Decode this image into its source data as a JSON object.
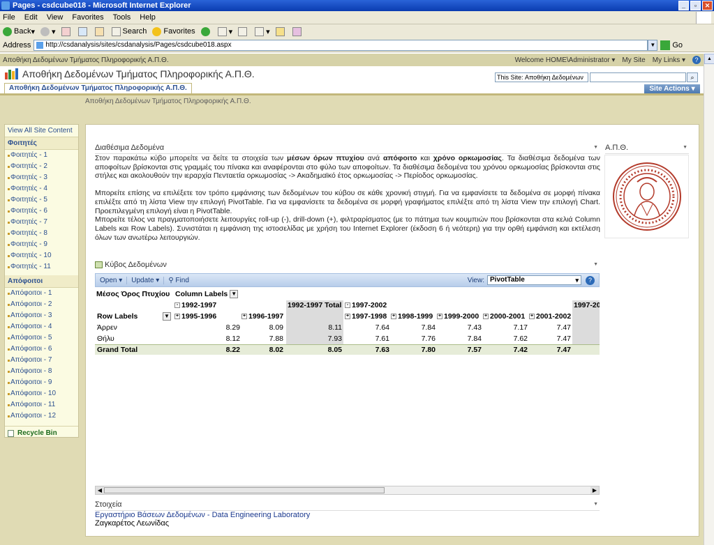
{
  "window": {
    "title": "Pages - csdcube018 - Microsoft Internet Explorer",
    "controls": [
      "_",
      "▫",
      "✕"
    ]
  },
  "menu": [
    "File",
    "Edit",
    "View",
    "Favorites",
    "Tools",
    "Help"
  ],
  "toolbar": {
    "back": "Back",
    "search": "Search",
    "favorites": "Favorites"
  },
  "address": {
    "label": "Address",
    "url": "http://csdanalysis/sites/csdanalysis/Pages/csdcube018.aspx",
    "go": "Go"
  },
  "sp_top": {
    "site_label": "Αποθήκη Δεδομένων Τμήματος Πληροφορικής Α.Π.Θ.",
    "welcome": "Welcome HOME\\Administrator ▾",
    "mysite": "My Site",
    "mylinks": "My Links ▾",
    "help": "?"
  },
  "header": {
    "title": "Αποθήκη Δεδομένων Τμήματος Πληροφορικής Α.Π.Θ.",
    "scope": "This Site: Αποθήκη Δεδομένων",
    "tab": "Αποθήκη Δεδομένων Τμήματος Πληροφορικής Α.Π.Θ.",
    "site_actions": "Site Actions ▾",
    "breadcrumb": "Αποθήκη Δεδομένων Τμήματος Πληροφορικής Α.Π.Θ."
  },
  "leftnav": {
    "view_all": "View All Site Content",
    "students_header": "Φοιτητές",
    "students": [
      "Φοιτητές - 1",
      "Φοιτητές - 2",
      "Φοιτητές - 3",
      "Φοιτητές - 4",
      "Φοιτητές - 5",
      "Φοιτητές - 6",
      "Φοιτητές - 7",
      "Φοιτητές - 8",
      "Φοιτητές - 9",
      "Φοιτητές - 10",
      "Φοιτητές - 11"
    ],
    "graduates_header": "Απόφοιτοι",
    "graduates": [
      "Απόφοιτοι - 1",
      "Απόφοιτοι - 2",
      "Απόφοιτοι - 3",
      "Απόφοιτοι - 4",
      "Απόφοιτοι - 5",
      "Απόφοιτοι - 6",
      "Απόφοιτοι - 7",
      "Απόφοιτοι - 8",
      "Απόφοιτοι - 9",
      "Απόφοιτοι - 10",
      "Απόφοιτοι - 11",
      "Απόφοιτοι - 12"
    ],
    "recycle": "Recycle Bin"
  },
  "available": {
    "title": "Διαθέσιμα Δεδομένα",
    "p1_a": "Στον παρακάτω κύβο μπορείτε να δείτε τα στοιχεία των ",
    "p1_b1": "μέσων όρων πτυχίου",
    "p1_c": " ανά ",
    "p1_b2": "απόφοιτο",
    "p1_d": " και ",
    "p1_b3": "χρόνο ορκωμοσίας",
    "p1_e": ". Τα διαθέσιμα δεδομένα των αποφοίτων βρίσκονται στις γραμμές του πίνακα και αναφέρονται στο φύλο των αποφοίτων. Τα διαθέσιμα δεδομένα του χρόνου ορκωμοσίας βρίσκονται στις στήλες και ακολουθούν την ιεραρχία Πενταετία ορκωμοσίας -> Ακαδημαϊκό έτος ορκωμοσίας -> Περίοδος ορκωμοσίας.",
    "p2": "Μπορείτε επίσης να επιλέξετε τον τρόπο εμφάνισης των δεδομένων του κύβου σε κάθε χρονική στιγμή. Για να εμφανίσετε τα δεδομένα σε μορφή πίνακα επιλέξτε από τη λίστα View την επιλογή PivotTable. Για να εμφανίσετε τα δεδομένα σε μορφή γραφήματος επιλέξτε από τη λίστα View την επιλογή Chart. Προεπιλεγμένη επιλογή είναι η PivotTable.",
    "p3": "Μπορείτε τέλος να πραγματοποιήσετε λειτουργίες roll-up (-), drill-down (+), φιλτραρίσματος (με το πάτημα των κουμπιών που βρίσκονται στα κελιά Column Labels και Row Labels). Συνιστάται η εμφάνιση της ιστοσελίδας με χρήση του Internet Explorer (έκδοση 6 ή νεότερη) για την ορθή εμφάνιση και εκτέλεση όλων των ανωτέρω λειτουργιών."
  },
  "seal_title": "Α.Π.Θ.",
  "cube": {
    "title": "Κύβος Δεδομένων",
    "open": "Open ▾",
    "update": "Update ▾",
    "find": "Find",
    "view_label": "View:",
    "view_value": "PivotTable",
    "measure": "Μέσος Όρος Πτυχίου",
    "column_labels": "Column Labels",
    "row_labels": "Row Labels",
    "period1": "1992-1997",
    "period1_total": "1992-1997 Total",
    "period2": "1997-2002",
    "period3": "1997-20",
    "years": [
      "1995-1996",
      "1996-1997",
      "1997-1998",
      "1998-1999",
      "1999-2000",
      "2000-2001",
      "2001-2002"
    ],
    "rows": [
      {
        "label": "Άρρεν",
        "values": [
          "8.29",
          "8.09",
          "8.11",
          "7.64",
          "7.84",
          "7.43",
          "7.17",
          "7.47"
        ]
      },
      {
        "label": "Θήλυ",
        "values": [
          "8.12",
          "7.88",
          "7.93",
          "7.61",
          "7.76",
          "7.84",
          "7.62",
          "7.47"
        ]
      }
    ],
    "grand_total": {
      "label": "Grand Total",
      "values": [
        "8.22",
        "8.02",
        "8.05",
        "7.63",
        "7.80",
        "7.57",
        "7.42",
        "7.47"
      ]
    }
  },
  "contact": {
    "title": "Στοιχεία",
    "link": "Εργαστήριο Βάσεων Δεδομένων - Data Engineering Laboratory",
    "name": "Ζαγκαρέτος Λεωνίδας"
  }
}
